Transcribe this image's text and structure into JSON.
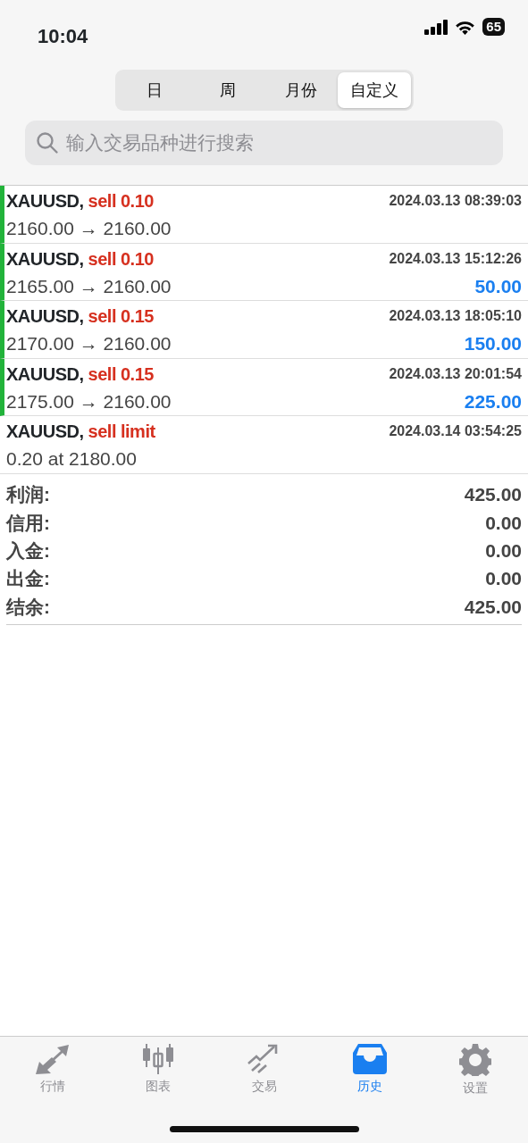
{
  "status_bar": {
    "time": "10:04",
    "battery": "65"
  },
  "period_tabs": [
    {
      "label": "日",
      "selected": false
    },
    {
      "label": "周",
      "selected": false
    },
    {
      "label": "月份",
      "selected": false
    },
    {
      "label": "自定义",
      "selected": true
    }
  ],
  "search": {
    "placeholder": "输入交易品种进行搜索"
  },
  "deals": [
    {
      "kind": "deal",
      "symbol": "XAUUSD,",
      "action": "sell 0.10",
      "time": "2024.03.13 08:39:03",
      "prices": "2160.00 → 2160.00"
    },
    {
      "kind": "deal",
      "symbol": "XAUUSD,",
      "action": "sell 0.10",
      "time": "2024.03.13 15:12:26",
      "prices": "2165.00 → 2160.00",
      "profit": "50.00"
    },
    {
      "kind": "deal",
      "symbol": "XAUUSD,",
      "action": "sell 0.15",
      "time": "2024.03.13 18:05:10",
      "prices": "2170.00 → 2160.00",
      "profit": "150.00"
    },
    {
      "kind": "deal",
      "symbol": "XAUUSD,",
      "action": "sell 0.15",
      "time": "2024.03.13 20:01:54",
      "prices": "2175.00 → 2160.00",
      "profit": "225.00"
    },
    {
      "kind": "order",
      "symbol": "XAUUSD,",
      "action": "sell limit",
      "time": "2024.03.14 03:54:25",
      "prices": "0.20 at 2180.00"
    }
  ],
  "summary": [
    {
      "label": "利润:",
      "value": "425.00"
    },
    {
      "label": "信用:",
      "value": "0.00"
    },
    {
      "label": "入金:",
      "value": "0.00"
    },
    {
      "label": "出金:",
      "value": "0.00"
    },
    {
      "label": "结余:",
      "value": "425.00"
    }
  ],
  "tab_bar": [
    {
      "kind": "quotes",
      "label": "行情",
      "selected": false
    },
    {
      "kind": "chart",
      "label": "图表",
      "selected": false
    },
    {
      "kind": "trade",
      "label": "交易",
      "selected": false
    },
    {
      "kind": "history",
      "label": "历史",
      "selected": true
    },
    {
      "kind": "settings",
      "label": "设置",
      "selected": false
    }
  ]
}
